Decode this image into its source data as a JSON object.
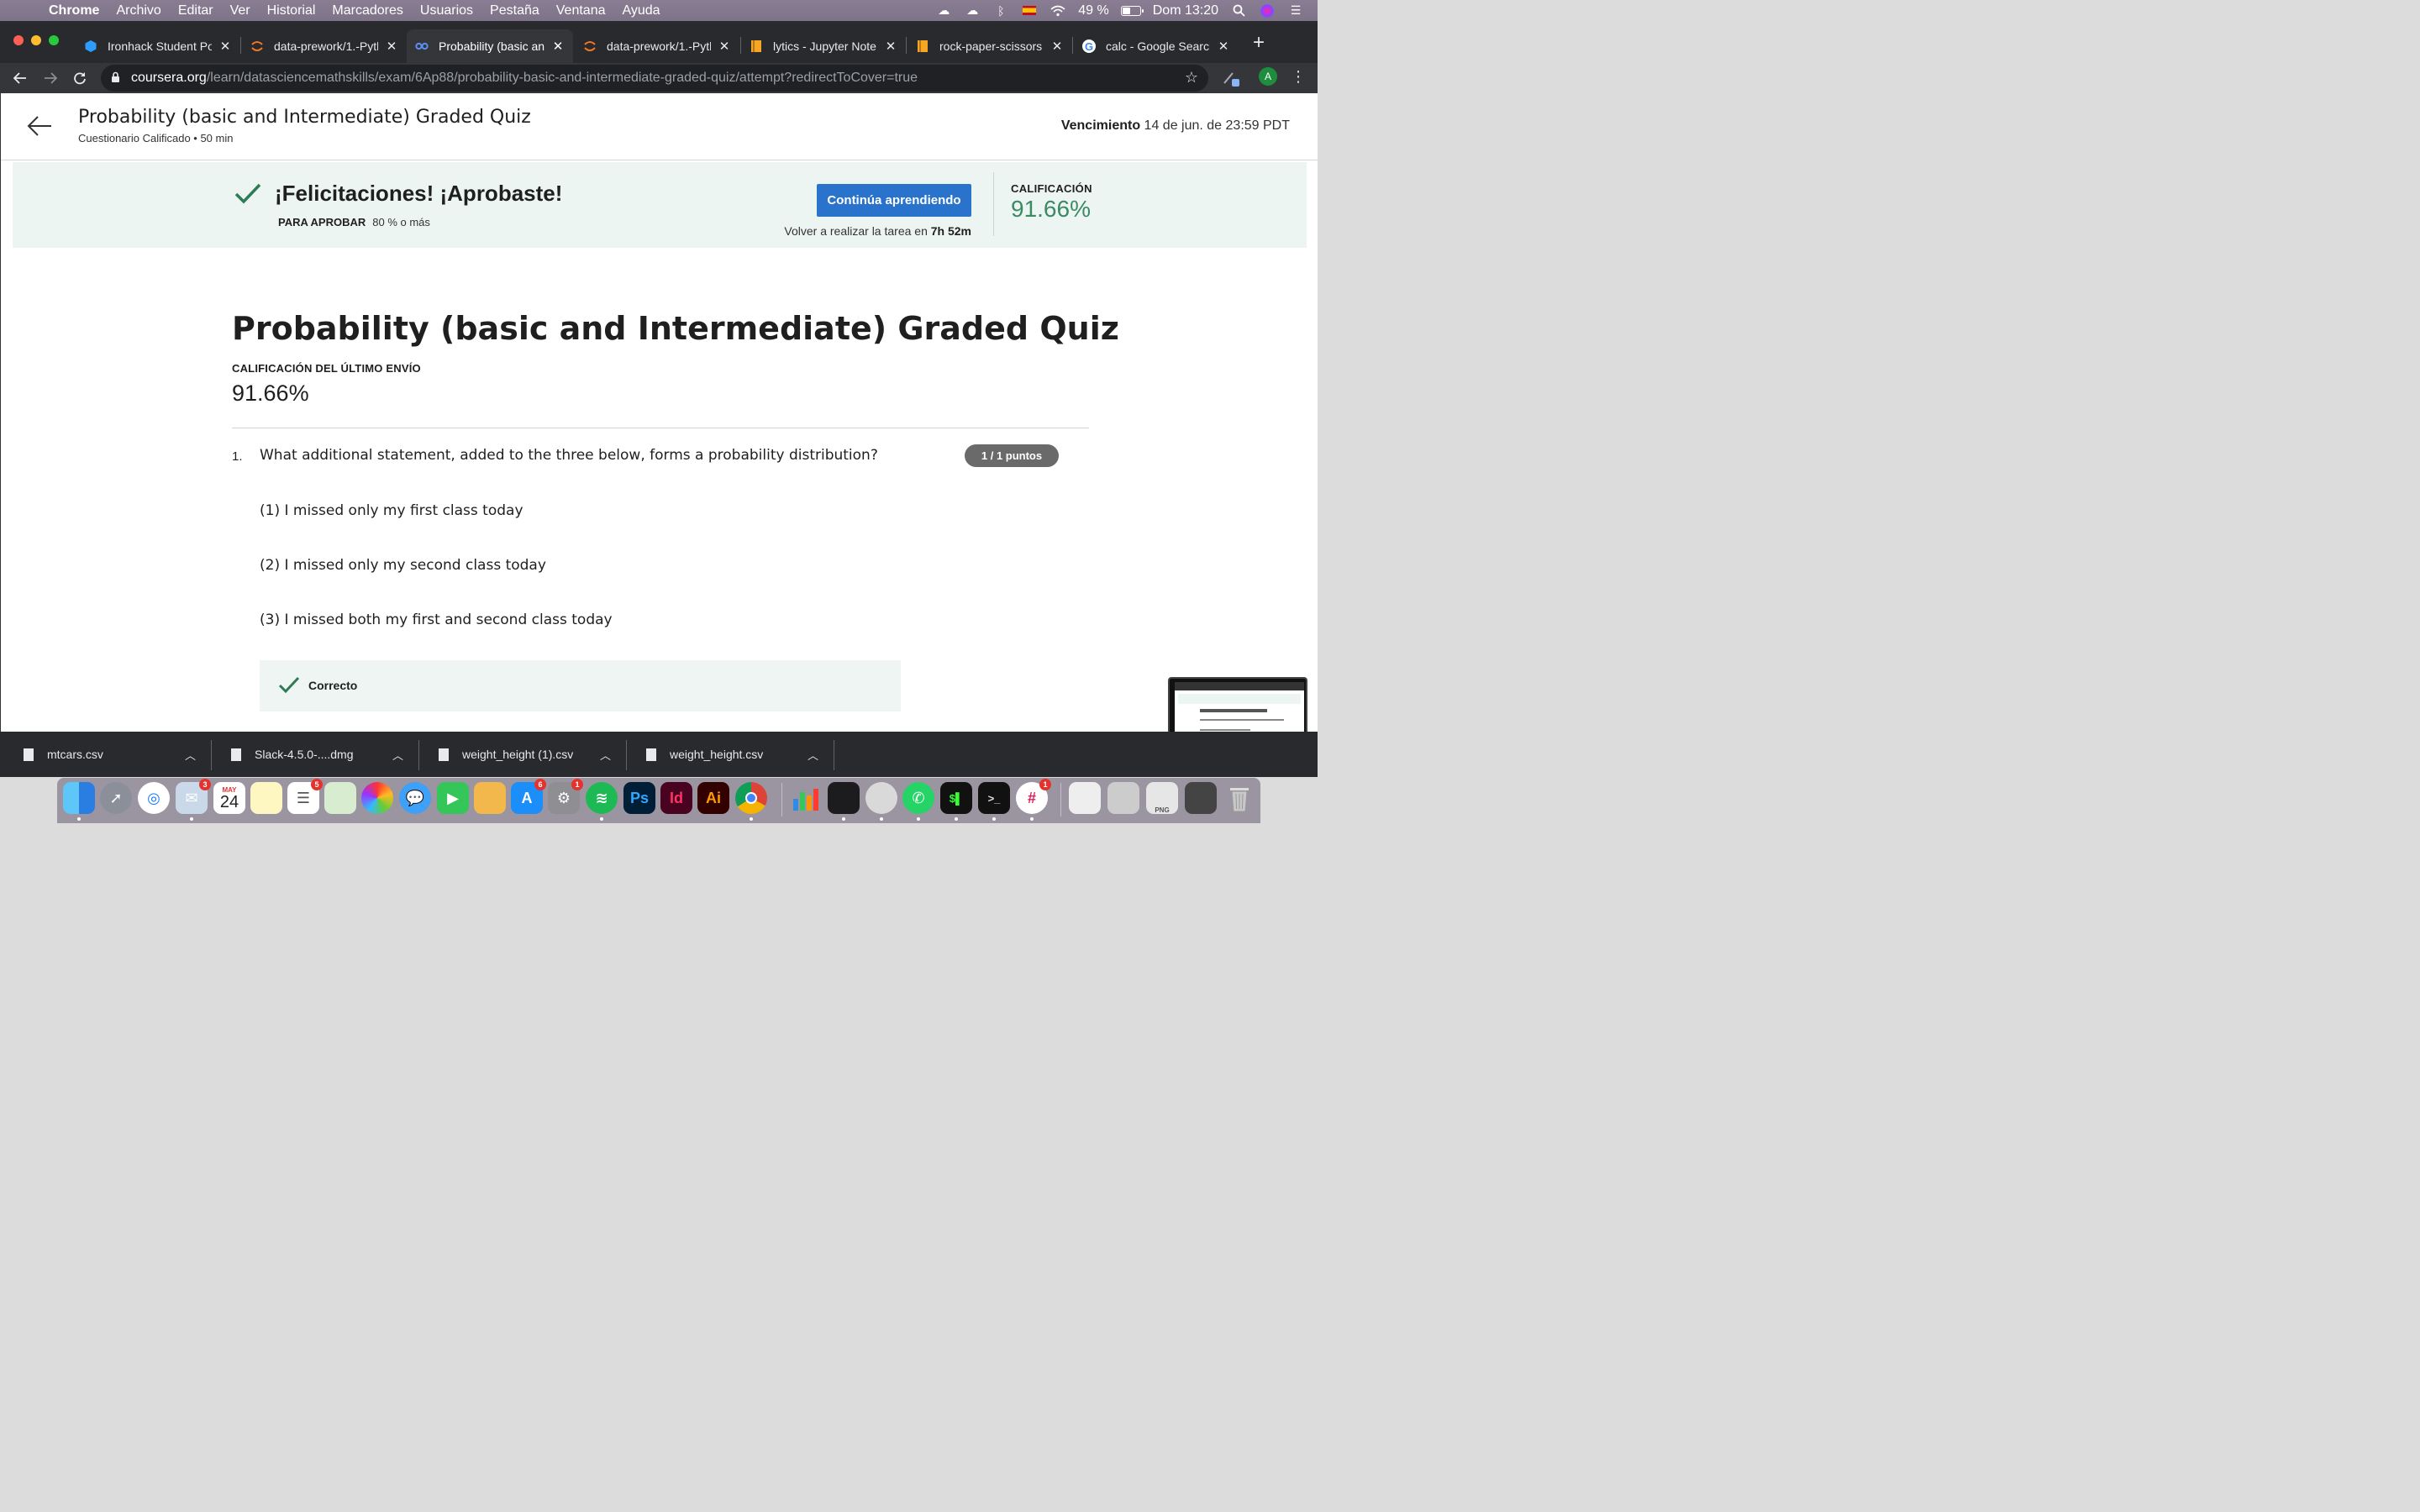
{
  "menubar": {
    "app": "Chrome",
    "items": [
      "Archivo",
      "Editar",
      "Ver",
      "Historial",
      "Marcadores",
      "Usuarios",
      "Pestaña",
      "Ventana",
      "Ayuda"
    ],
    "battery_text": "49 %",
    "battery_level": 0.49,
    "clock": "Dom 13:20"
  },
  "tabs": [
    {
      "title": "Ironhack Student Po",
      "icon": "ironhack-icon"
    },
    {
      "title": "data-prework/1.-Pytl",
      "icon": "jupyter-icon"
    },
    {
      "title": "Probability (basic an",
      "icon": "coursera-icon",
      "active": true
    },
    {
      "title": "data-prework/1.-Pytl",
      "icon": "jupyter-icon"
    },
    {
      "title": "lytics - Jupyter Note",
      "icon": "notebook-icon"
    },
    {
      "title": "rock-paper-scissors",
      "icon": "notebook-icon"
    },
    {
      "title": "calc - Google Search",
      "icon": "google-icon"
    }
  ],
  "address": {
    "host": "coursera.org",
    "path": "/learn/datasciencemathskills/exam/6Ap88/probability-basic-and-intermediate-graded-quiz/attempt?redirectToCover=true"
  },
  "profile_initial": "A",
  "header": {
    "title": "Probability (basic and Intermediate) Graded Quiz",
    "subtitle": "Cuestionario Calificado • 50 min",
    "due_label": "Vencimiento",
    "due_value": "14 de jun. de 23:59 PDT"
  },
  "banner": {
    "title": "¡Felicitaciones! ¡Aprobaste!",
    "pass_label": "PARA APROBAR",
    "pass_value": "80 % o más",
    "button": "Continúa aprendiendo",
    "retry_text": "Volver a realizar la tarea en",
    "retry_time": "7h 52m",
    "grade_label": "CALIFICACIÓN",
    "grade_value": "91.66%"
  },
  "quiz": {
    "title": "Probability (basic and Intermediate) Graded Quiz",
    "last_label": "CALIFICACIÓN DEL ÚLTIMO ENVÍO",
    "last_grade": "91.66%",
    "question": {
      "number": "1.",
      "text": "What additional statement, added to the three below, forms a probability distribution?",
      "points": "1 / 1 puntos",
      "statements": [
        "(1) I missed only my first class today",
        "(2) I missed only my second class today",
        "(3) I missed both my first and second class today"
      ],
      "feedback": "Correcto"
    }
  },
  "downloads": [
    {
      "name": "mtcars.csv"
    },
    {
      "name": "Slack-4.5.0-....dmg"
    },
    {
      "name": "weight_height (1).csv"
    },
    {
      "name": "weight_height.csv"
    }
  ],
  "dock": {
    "calendar_month": "MAY",
    "calendar_day": "24",
    "badges": {
      "mail": "3",
      "reminders": "5",
      "appstore": "6",
      "prefs": "1",
      "slack": "1"
    },
    "labels": {
      "ps": "Ps",
      "id": "Id",
      "ai": "Ai",
      "png": "PNG"
    }
  }
}
